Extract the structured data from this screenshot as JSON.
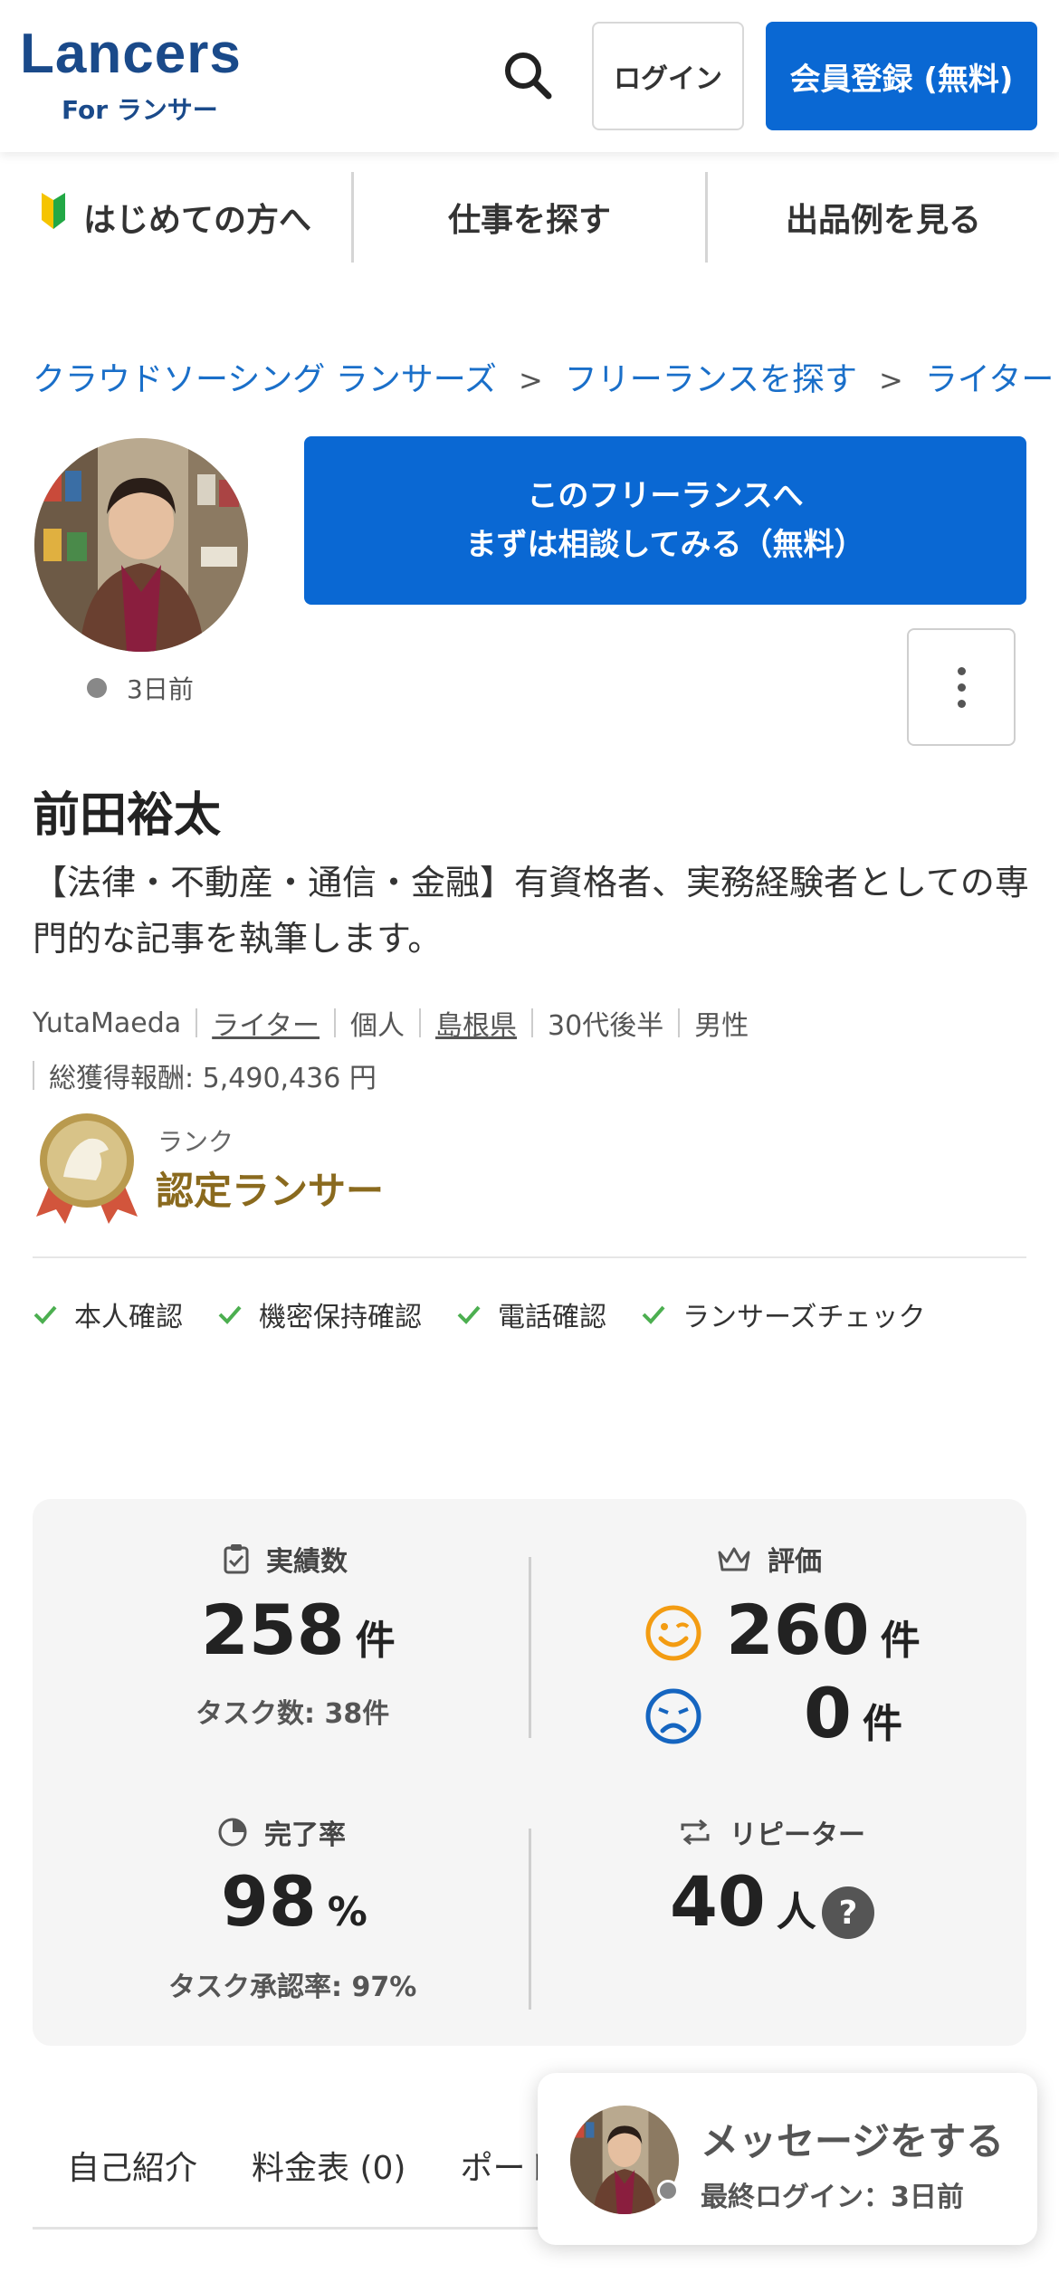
{
  "header": {
    "logo_main": "Lancers",
    "logo_sub": "For ランサー",
    "login_label": "ログイン",
    "register_label": "会員登録 (無料)"
  },
  "nav": {
    "items": [
      {
        "label": "はじめての方へ"
      },
      {
        "label": "仕事を探す"
      },
      {
        "label": "出品例を見る"
      }
    ]
  },
  "breadcrumb": [
    "クラウドソーシング ランサーズ",
    "フリーランスを探す",
    "ライター"
  ],
  "profile": {
    "last_seen": "3日前",
    "consult_line1": "このフリーランスへ",
    "consult_line2": "まずは相談してみる（無料）",
    "name": "前田裕太",
    "catchphrase": "【法律・不動産・通信・金融】有資格者、実務経験者としての専門的な記事を執筆します。",
    "username": "YutaMaeda",
    "occupation": "ライター",
    "type": "個人",
    "prefecture": "島根県",
    "age": "30代後半",
    "gender": "男性",
    "total_earnings": "総獲得報酬: 5,490,436 円",
    "rank_label": "ランク",
    "rank_value": "認定ランサー",
    "checks": [
      "本人確認",
      "機密保持確認",
      "電話確認",
      "ランサーズチェック"
    ]
  },
  "stats": {
    "achievements_label": "実績数",
    "achievements_value": "258",
    "achievements_unit": "件",
    "tasks": "タスク数: 38件",
    "rating_label": "評価",
    "good_value": "260",
    "good_unit": "件",
    "bad_value": "0",
    "bad_unit": "件",
    "completion_label": "完了率",
    "completion_value": "98",
    "completion_unit": "%",
    "task_approval": "タスク承認率: 97%",
    "repeater_label": "リピーター",
    "repeater_value": "40",
    "repeater_unit": "人",
    "help_mark": "?"
  },
  "tabs": [
    {
      "label": "自己紹介"
    },
    {
      "label": "料金表 (0)"
    },
    {
      "label": "ポート"
    }
  ],
  "message": {
    "title": "メッセージをする",
    "subtitle": "最終ログイン：3日前"
  },
  "colors": {
    "brand_blue": "#0a68d3",
    "logo_navy": "#1a4a8a",
    "link_blue": "#1a6fc9",
    "rank_gold": "#8a6a1e",
    "check_green": "#4caf50",
    "good_orange": "#f39c12",
    "bad_blue": "#1565c0"
  }
}
